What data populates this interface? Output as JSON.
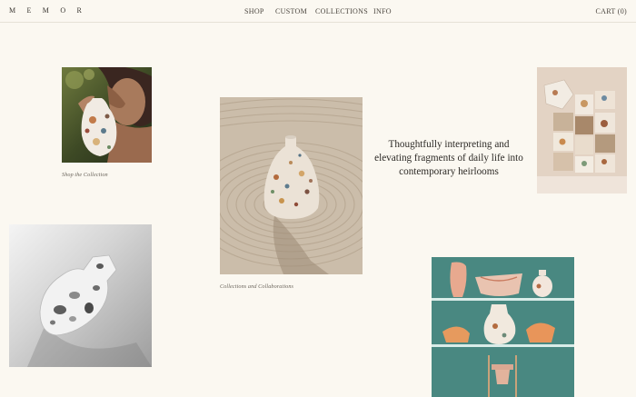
{
  "header": {
    "logo": "M E M O R",
    "nav": [
      "SHOP",
      "CUSTOM",
      "COLLECTIONS",
      "INFO"
    ],
    "cart": "CART (0)"
  },
  "main": {
    "headline": "Thoughtfully interpreting and elevating fragments of daily life into contemporary heirlooms",
    "caption_shop": "Shop the Collection",
    "caption_collections": "Collections and Collaborations"
  },
  "images": {
    "woman_vase": "photo of woman holding terrazzo vase",
    "sand_vase": "terrazzo vase on raked sand",
    "collage": "terrazzo fragments collage",
    "bw_vase": "black and white vase on stone",
    "shelf": "ceramic pieces on teal shelves"
  }
}
